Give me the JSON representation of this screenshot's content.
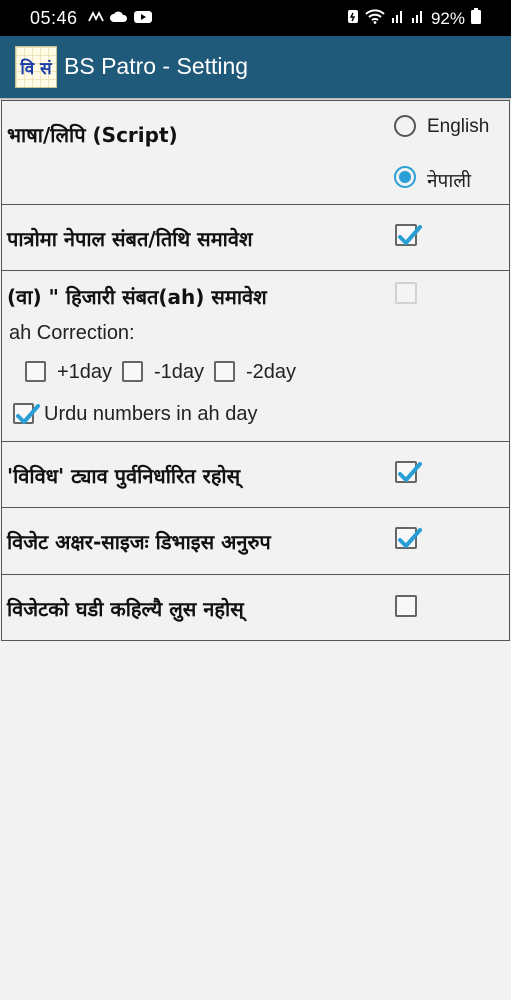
{
  "status_bar": {
    "time": "05:46",
    "left_icons": [
      "vibrate-icon",
      "cloud-icon",
      "youtube-icon"
    ],
    "battery_percent": "92%",
    "right_icons": [
      "battery-saver-icon",
      "wifi-icon",
      "signal-icon",
      "signal-icon",
      "battery-icon"
    ]
  },
  "app_bar": {
    "logo_text": "वि सं",
    "title": "BS Patro - Setting",
    "color": "#205a7a"
  },
  "settings": {
    "script": {
      "label": "भाषा/लिपि (Script)",
      "options": [
        {
          "label": "English",
          "selected": false
        },
        {
          "label": "नेपाली",
          "selected": true
        }
      ]
    },
    "nepal_sambat": {
      "label": "पात्रोमा नेपाल संबत/तिथि समावेश",
      "checked": true
    },
    "hijari": {
      "label": "(वा) \" हिजारी संबत(ah) समावेश",
      "checked": false,
      "enabled": false,
      "correction_label": "ah Correction:",
      "corrections": [
        {
          "label": "+1day",
          "checked": false
        },
        {
          "label": "-1day",
          "checked": false
        },
        {
          "label": "-2day",
          "checked": false
        }
      ],
      "urdu_label": "Urdu numbers in ah day",
      "urdu_checked": true
    },
    "vividh": {
      "label": "'विविध' ट्याव पुर्वनिर्धारित रहोस्",
      "checked": true
    },
    "widget_size": {
      "label": "विजेट अक्षर-साइजः डिभाइस अनुरुप",
      "checked": true
    },
    "widget_clock": {
      "label": "विजेटको घडी कहिल्यै लुस नहोस्",
      "checked": false
    }
  },
  "colors": {
    "accent": "#2a9fd6",
    "app_bar": "#205a7a"
  }
}
